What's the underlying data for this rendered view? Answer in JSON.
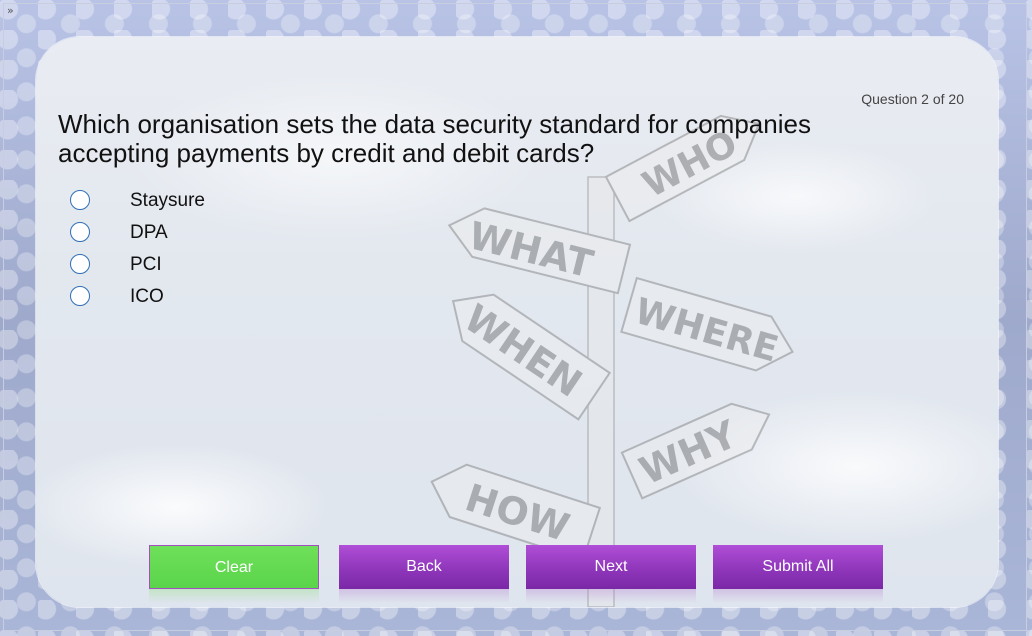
{
  "quiz": {
    "counter": "Question 2 of 20",
    "question": "Which organisation sets the data security standard for companies accepting payments by credit and debit cards?",
    "options": [
      "Staysure",
      "DPA",
      "PCI",
      "ICO"
    ]
  },
  "signs": [
    "WHO",
    "WHAT",
    "WHERE",
    "WHEN",
    "WHY",
    "HOW"
  ],
  "buttons": {
    "clear": "Clear",
    "back": "Back",
    "next": "Next",
    "submit": "Submit All"
  },
  "colors": {
    "button_purple": "#8f36bb",
    "button_green": "#5ad44b",
    "radio_border": "#2f6fb8"
  },
  "icons": {
    "expand": "»"
  }
}
